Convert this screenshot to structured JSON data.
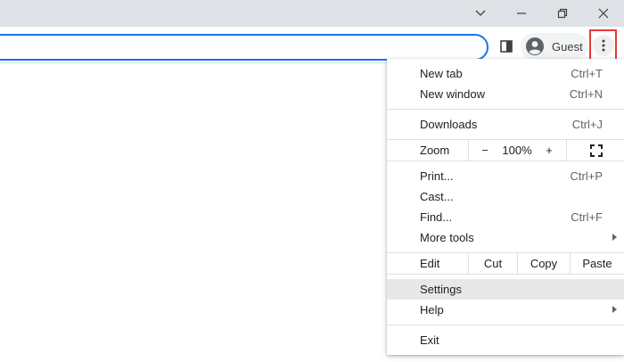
{
  "toolbar": {
    "profile_label": "Guest",
    "menu_button_highlight": "#e53935",
    "omnibox_accent": "#1a73e8"
  },
  "titlebar": {
    "icons": [
      "chevron-down-icon",
      "minimize-icon",
      "restore-icon",
      "close-icon"
    ]
  },
  "menu": {
    "new_tab": {
      "label": "New tab",
      "shortcut": "Ctrl+T"
    },
    "new_window": {
      "label": "New window",
      "shortcut": "Ctrl+N"
    },
    "downloads": {
      "label": "Downloads",
      "shortcut": "Ctrl+J"
    },
    "zoom": {
      "label": "Zoom",
      "minus": "−",
      "level": "100%",
      "plus": "+"
    },
    "print": {
      "label": "Print...",
      "shortcut": "Ctrl+P"
    },
    "cast": {
      "label": "Cast..."
    },
    "find": {
      "label": "Find...",
      "shortcut": "Ctrl+F"
    },
    "more_tools": {
      "label": "More tools"
    },
    "edit": {
      "label": "Edit",
      "cut": "Cut",
      "copy": "Copy",
      "paste": "Paste"
    },
    "settings": {
      "label": "Settings"
    },
    "help": {
      "label": "Help"
    },
    "exit": {
      "label": "Exit"
    }
  }
}
